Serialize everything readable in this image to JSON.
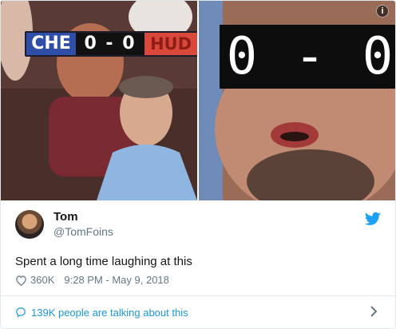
{
  "media": {
    "left_scoreboard": {
      "home": "CHE",
      "score": "0 - 0",
      "away": "HUD"
    },
    "right_scoreboard": {
      "score": "0 - 0"
    },
    "info_icon": "info-icon"
  },
  "tweet": {
    "author_name": "Tom",
    "author_handle": "@TomFoins",
    "text": "Spent a long time laughing at this",
    "likes": "360K",
    "timestamp": "9:28 PM - May 9, 2018",
    "conversation": "139K people are talking about this",
    "icons": {
      "logo": "twitter-bird-icon",
      "like": "heart-icon",
      "conversation": "speech-bubble-icon",
      "chevron": "chevron-right-icon"
    }
  },
  "colors": {
    "link": "#1b95e0",
    "secondary": "#657786",
    "brand": "#1da1f2"
  }
}
